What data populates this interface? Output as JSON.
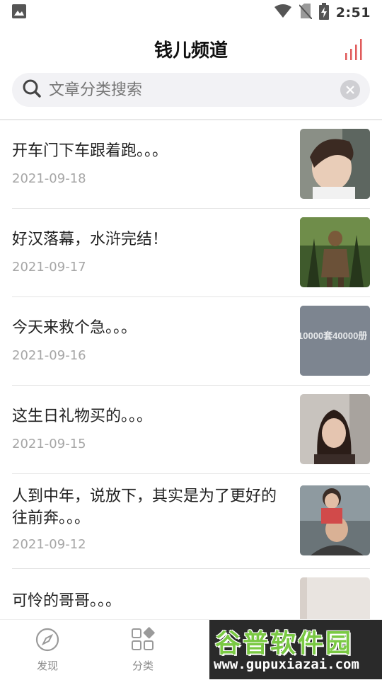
{
  "status_bar": {
    "time": "2:51"
  },
  "header": {
    "title": "钱儿频道"
  },
  "search": {
    "placeholder": "文章分类搜索"
  },
  "articles": [
    {
      "title": "开车门下车跟着跑。。。",
      "date": "2021-09-18"
    },
    {
      "title": "好汉落幕，水浒完结！",
      "date": "2021-09-17"
    },
    {
      "title": "今天来救个急。。。",
      "date": "2021-09-16",
      "thumb_text": "10000套40000册"
    },
    {
      "title": "这生日礼物买的。。。",
      "date": "2021-09-15"
    },
    {
      "title": "人到中年，说放下，其实是为了更好的往前奔。。。",
      "date": "2021-09-12"
    },
    {
      "title": "可怜的哥哥。。。"
    }
  ],
  "nav": {
    "discover_label": "发现",
    "category_label": "分类"
  },
  "watermark": {
    "cn": "谷普软件园",
    "url": "www.gupuxiazai.com"
  },
  "colors": {
    "accent": "#e05a5a",
    "watermark_green": "#7ac943"
  }
}
